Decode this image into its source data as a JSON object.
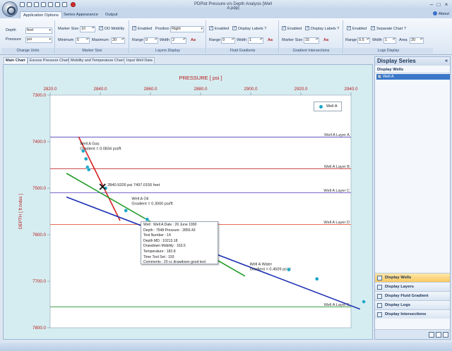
{
  "window": {
    "title": "PDPlot Pressure v/s Depth Analysis [Well A.pdp]"
  },
  "menu_tabs": [
    "Application Options",
    "Series Appearance",
    "Output"
  ],
  "about_label": "About",
  "ribbon": {
    "change_units": {
      "group_label": "Change Units",
      "depth_label": "Depth",
      "depth_unit": "feet",
      "pressure_label": "Pressure",
      "pressure_unit": "psi"
    },
    "marker_size": {
      "group_label": "Marker Size",
      "marker_size_label": "Marker Size",
      "marker_size_value": "10",
      "dd_mobility_label": "DD Mobility",
      "minimum_label": "Minimum",
      "minimum_value": "5",
      "maximum_label": "Maximum",
      "maximum_value": "20"
    },
    "layers_display": {
      "group_label": "Layers Display",
      "enabled_label": "Enabled",
      "position_label": "Position",
      "position_value": "Right",
      "range_label": "Range",
      "range_value": "0",
      "width_label": "Width",
      "width_value": "2"
    },
    "fluid_gradients": {
      "group_label": "Fluid Gradients",
      "enabled_label": "Enabled",
      "display_labels_label": "Display Labels ?",
      "range_label": "Range",
      "range_value": "0",
      "width_label": "Width",
      "width_value": "1"
    },
    "gradient_intersections": {
      "group_label": "Gradient Intersections",
      "enabled_label": "Enabled",
      "display_labels_label": "Display Labels ?",
      "marker_size_label": "Marker Size",
      "marker_size_value": "15"
    },
    "logs_display": {
      "group_label": "Logs Display",
      "enabled_label": "Enabled",
      "separate_chart_label": "Separate Chart ?",
      "range_label": "Range",
      "range_value": "0.5",
      "width_label": "Width",
      "width_value": "1",
      "area_label": "Area",
      "area_value": "20"
    },
    "font_icon": "Aa"
  },
  "chart_tabs": [
    "Main Chart",
    "Excess Pressure Chart",
    "Mobility and Temperature Chart",
    "Input Well Data"
  ],
  "chart_data": {
    "type": "scatter",
    "title": "PRESSURE [ psi ]",
    "ylabel": "DEPTH [ ft.tvdss ]",
    "xlim": [
      2820,
      2940
    ],
    "ylim": [
      7300,
      7800
    ],
    "x_ticks": [
      "2820.0",
      "2840.0",
      "2860.0",
      "2880.0",
      "2900.0",
      "2920.0",
      "2940.0"
    ],
    "y_ticks": [
      "7300.0",
      "7400.0",
      "7500.0",
      "7600.0",
      "7700.0",
      "7800.0"
    ],
    "legend": [
      "Well A"
    ],
    "series": [
      {
        "name": "Well A",
        "color": "#1aa7c8",
        "points": [
          [
            2833.2,
            7420
          ],
          [
            2834.3,
            7437
          ],
          [
            2834.9,
            7455
          ],
          [
            2835.4,
            7460
          ],
          [
            2842.1,
            7500
          ],
          [
            2850.2,
            7548
          ],
          [
            2858.7,
            7567
          ],
          [
            2915.2,
            7675
          ],
          [
            2926.4,
            7695
          ],
          [
            2945.1,
            7744
          ]
        ]
      }
    ],
    "layers": [
      {
        "name": "Well A Layer A",
        "depth": 7390,
        "color": "#4b41b8"
      },
      {
        "name": "Well A Layer B",
        "depth": 7458,
        "color": "#c22727"
      },
      {
        "name": "Well A Layer C",
        "depth": 7510,
        "color": "#6a4fc4"
      },
      {
        "name": "Well A Layer D",
        "depth": 7578,
        "color": "#e05a3a"
      },
      {
        "name": "Well A Layer E",
        "depth": 7755,
        "color": "#1f8f2b"
      }
    ],
    "gradients": [
      {
        "label_name": "Well A Gas",
        "label_value": "Gradient = 0.0834 psi/ft",
        "color": "#d42020",
        "from": [
          2831.4,
          7390
        ],
        "to": [
          2847.9,
          7570
        ],
        "label_at": [
          2831.9,
          7407
        ]
      },
      {
        "label_name": "Well A Oil",
        "label_value": "Gradient = 0.3000 psi/ft",
        "color": "#1f9a26",
        "from": [
          2826.5,
          7468
        ],
        "to": [
          2897.7,
          7689
        ],
        "label_at": [
          2852.5,
          7525
        ]
      },
      {
        "label_name": "Well A Water",
        "label_value": "Gradient = 0.4509 psi/ft",
        "color": "#1b2fb3",
        "from": [
          2826.5,
          7519
        ],
        "to": [
          2943.6,
          7760
        ],
        "label_at": [
          2899.6,
          7666
        ]
      }
    ],
    "intersection": {
      "label": "2840.9326 psi 7497.0155 feet",
      "x": 2840.9,
      "y": 7497
    }
  },
  "tooltip": {
    "lines": [
      "Well : Well A  Date : 26 June 1990",
      "Depth : 7548   Pressure : 2855.43",
      "Test Number : 14",
      "Depth MD : 10213.18",
      "Drawdown Mobility : 163.5",
      "Temperature : 182.8",
      "Time Tool Set : 193",
      "Comments : 20 cc drawdown good test"
    ]
  },
  "right_panel": {
    "title": "Display Series",
    "subheader": "Display Wells",
    "item": "Well A",
    "buttons": [
      "Display Wells",
      "Display Layers",
      "Display Fluid Gradient",
      "Display Logs",
      "Display Intersections"
    ]
  }
}
